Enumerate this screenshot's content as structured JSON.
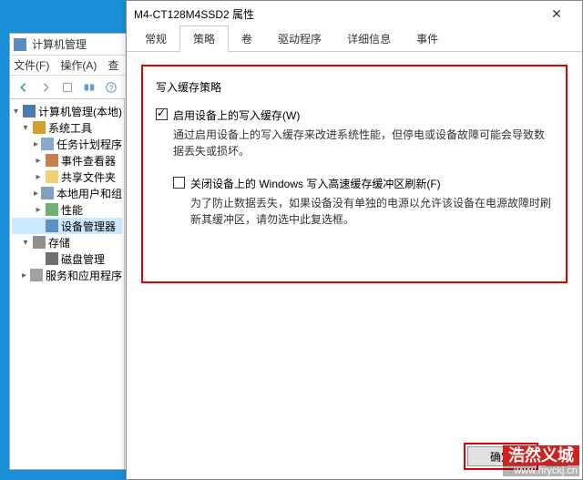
{
  "mgmt": {
    "title": "计算机管理",
    "menu": {
      "file": "文件(F)",
      "action": "操作(A)",
      "view": "查"
    },
    "tree": {
      "root": "计算机管理(本地)",
      "systools": "系统工具",
      "task": "任务计划程序",
      "event": "事件查看器",
      "shared": "共享文件夹",
      "users": "本地用户和组",
      "perf": "性能",
      "device": "设备管理器",
      "storage": "存储",
      "disk": "磁盘管理",
      "services": "服务和应用程序"
    }
  },
  "prop": {
    "title": "M4-CT128M4SSD2 属性",
    "tabs": {
      "general": "常规",
      "policy": "策略",
      "volumes": "卷",
      "driver": "驱动程序",
      "details": "详细信息",
      "events": "事件"
    },
    "group_label": "写入缓存策略",
    "cb1_label": "启用设备上的写入缓存(W)",
    "cb1_desc": "通过启用设备上的写入缓存来改进系统性能，但停电或设备故障可能会导致数据丢失或损坏。",
    "cb2_label": "关闭设备上的 Windows 写入高速缓存缓冲区刷新(F)",
    "cb2_desc": "为了防止数据丢失，如果设备没有单独的电源以允许该设备在电源故障时刷新其缓冲区，请勿选中此复选框。",
    "ok": "确定"
  },
  "watermark": {
    "logo": "浩然义城",
    "url": "www.hryckj.cn"
  }
}
